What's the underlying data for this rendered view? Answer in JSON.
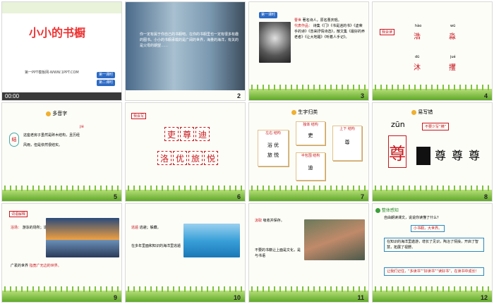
{
  "s1": {
    "title": "小小的书橱",
    "caption": "第一PPT模板网-WWW.1PPT.COM",
    "btn1": "第一课时",
    "btn2": "第二课时",
    "time": "00:00"
  },
  "s2": {
    "text": "你一定有属于你自己的书橱吧。在你的书橱里也一定有很多有趣的图书。小小的书橱承载的是广阔的世界，海量的海洋，有关的是父母的期望……"
  },
  "s3": {
    "btn": "第一课时",
    "name": "曹世",
    "intro": "著名诗人，原名曹庆琨。",
    "works_label": "代表作品：",
    "works": "诗集《门》《书是迷的书》《虚荣手的诗》《曾来抒情诗选》，散文集《最好的养老者》《让大地醒》《听着人手记》。"
  },
  "s4": {
    "tag": "我会读",
    "pinyin": [
      "hào",
      "wū",
      "dū",
      "jué"
    ],
    "chars": [
      "浩",
      "淼",
      "沐",
      "攫"
    ]
  },
  "s5": {
    "header": "多音字",
    "pinyin": "jié",
    "pinyin2": "jiē",
    "circle": "结",
    "line1": "这座老房子虽然是砖木结构，且历经",
    "line2": "风雨，但是依然很结实。"
  },
  "s6": {
    "tag": "我会写",
    "row1": [
      "吏",
      "尊",
      "迪"
    ],
    "row2": [
      "洛",
      "优",
      "旅",
      "悦"
    ]
  },
  "s7": {
    "header": "生字归类",
    "cards": [
      {
        "label": "左右 结构",
        "chars": "浴 优\n旅 悦"
      },
      {
        "label": "独体 结构",
        "chars": "吏"
      },
      {
        "label": "上下 结构",
        "chars": "尊"
      },
      {
        "label": "半包围 结构",
        "chars": "迪"
      }
    ]
  },
  "s8": {
    "header": "易写错",
    "pinyin": "zūn",
    "hint": "不要少写“横”",
    "char": "尊"
  },
  "s9": {
    "tag": "词语解释",
    "term1": "浴场：",
    "def1": "游泳的场所；泳场。",
    "term2": "广袤的世界",
    "def2": "指宽广无边的世界。"
  },
  "s10": {
    "term1": "逃遁",
    "def1": "逃避；躲藏。",
    "term2": "在多年里面和知识的海洋里逃遁"
  },
  "s11": {
    "term1": "汲取",
    "def1": "吸收并保存。",
    "term2": "不要的书籍让上面是文化，是与书语"
  },
  "s12": {
    "header": "整体感知",
    "q": "自由朗读课文，说说你读懂了什么？",
    "a1": "小书橱，大世界。",
    "a2": "在知识的海洋里遨游，增长了见识，陶冶了情操，开启了智慧，拓展了视野。",
    "a3": "让我们记住，“多读书”“好读书”“读好书”，在读书中成长！"
  },
  "nums": [
    "1",
    "2",
    "3",
    "4",
    "5",
    "6",
    "7",
    "8",
    "9",
    "10",
    "11",
    "12"
  ]
}
